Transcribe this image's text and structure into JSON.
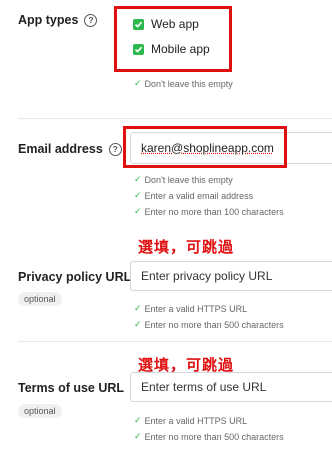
{
  "app_types": {
    "label": "App types",
    "options": [
      {
        "label": "Web app",
        "checked": true
      },
      {
        "label": "Mobile app",
        "checked": true
      }
    ],
    "hints": [
      "Don't leave this empty"
    ]
  },
  "email": {
    "label": "Email address",
    "value": "karen@shoplineapp.com",
    "hints": [
      "Don't leave this empty",
      "Enter a valid email address",
      "Enter no more than 100 characters"
    ]
  },
  "privacy": {
    "annotation": "選填，可跳過",
    "label": "Privacy policy URL",
    "optional": "optional",
    "placeholder": "Enter privacy policy URL",
    "hints": [
      "Enter a valid HTTPS URL",
      "Enter no more than 500 characters"
    ]
  },
  "terms": {
    "annotation": "選填，可跳過",
    "label": "Terms of use URL",
    "optional": "optional",
    "placeholder": "Enter terms of use URL",
    "hints": [
      "Enter a valid HTTPS URL",
      "Enter no more than 500 characters"
    ]
  },
  "colors": {
    "check_green": "#2db84d",
    "annotation_red": "#e01010"
  }
}
